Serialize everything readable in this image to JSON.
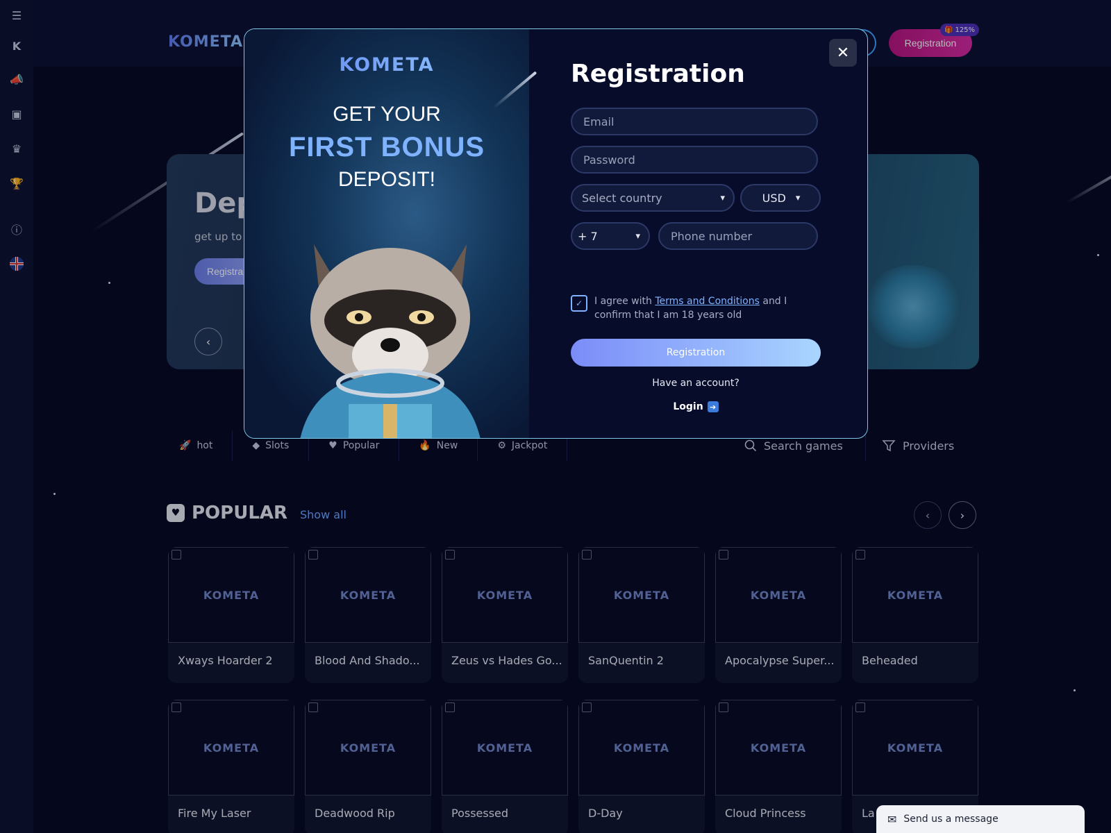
{
  "rail": {
    "icons": [
      "menu-icon",
      "kometa-k-icon",
      "megaphone-icon",
      "wallet-icon",
      "crown-icon",
      "trophy-icon",
      "info-icon",
      "uk-flag-icon"
    ]
  },
  "header": {
    "logo": "KOMETA",
    "registration_label": "Registration",
    "bonus_badge": "125%"
  },
  "hero": {
    "title": "Dep",
    "subtitle": "get up to",
    "button_label": "Registra",
    "prev_arrow": "‹"
  },
  "categories": {
    "items": [
      {
        "label": "hot",
        "icon": "rocket-icon",
        "glyph": "🚀"
      },
      {
        "label": "Slots",
        "icon": "diamond-icon",
        "glyph": "◆"
      },
      {
        "label": "Popular",
        "icon": "heart-icon",
        "glyph": "♥"
      },
      {
        "label": "New",
        "icon": "flame-icon",
        "glyph": "🔥"
      },
      {
        "label": "Jackpot",
        "icon": "coin-icon",
        "glyph": "⚙"
      }
    ],
    "search_label": "Search games",
    "providers_label": "Providers"
  },
  "popular": {
    "title": "POPULAR",
    "show_all": "Show all",
    "games": [
      "Xways Hoarder 2",
      "Blood And Shado...",
      "Zeus vs Hades Go...",
      "SanQuentin 2",
      "Apocalypse Super...",
      "Beheaded",
      "Fire My Laser",
      "Deadwood Rip",
      "Possessed",
      "D-Day",
      "Cloud Princess",
      "La"
    ],
    "card_logo": "KOMETA"
  },
  "modal": {
    "promo_logo": "KOMETA",
    "promo_line1": "GET YOUR",
    "promo_line2": "FIRST BONUS",
    "promo_line3": "DEPOSIT!",
    "title": "Registration",
    "email_placeholder": "Email",
    "password_placeholder": "Password",
    "country_placeholder": "Select country",
    "currency": "USD",
    "phone_code": "+ 7",
    "phone_placeholder": "Phone number",
    "agree_prefix": "I agree with",
    "terms_link": "Terms and Conditions",
    "agree_suffix": "and I confirm that I am 18 years old",
    "submit_label": "Registration",
    "have_account": "Have an account?",
    "login_label": "Login"
  },
  "chat": {
    "label": "Send us a message"
  },
  "colors": {
    "background": "#060a22",
    "accent_magenta": "#d62aa0",
    "accent_blue": "#7fb2ff"
  }
}
